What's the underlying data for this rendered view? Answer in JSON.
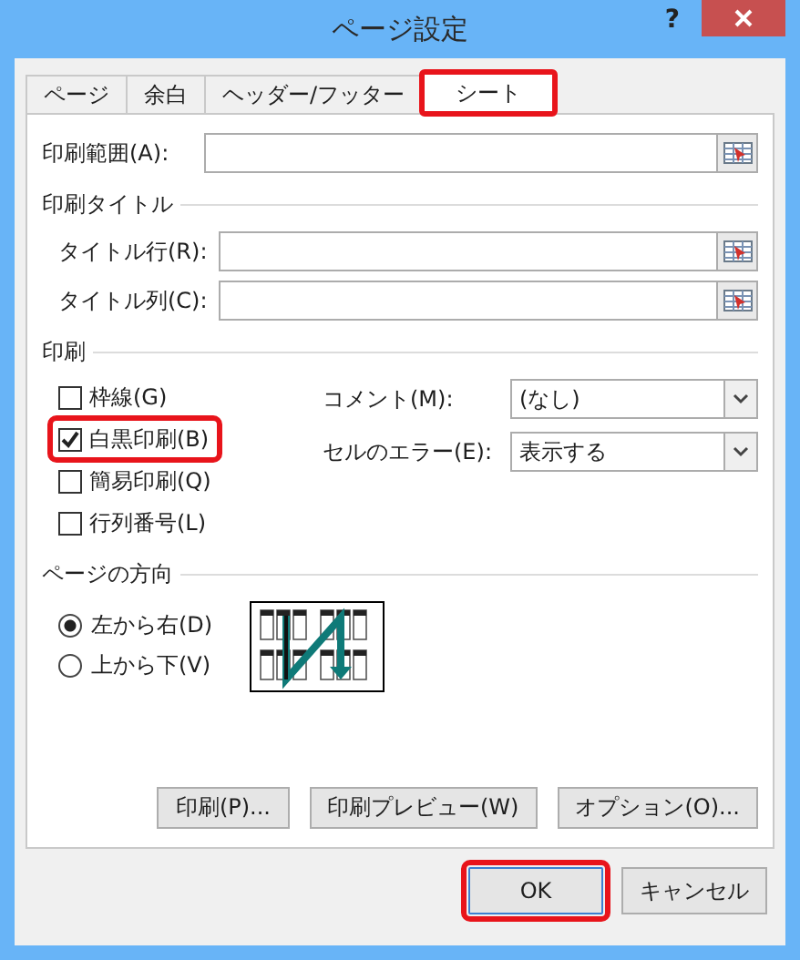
{
  "window": {
    "title": "ページ設定",
    "help": "?"
  },
  "tabs": [
    {
      "label": "ページ",
      "selected": false,
      "highlighted": false
    },
    {
      "label": "余白",
      "selected": false,
      "highlighted": false
    },
    {
      "label": "ヘッダー/フッター",
      "selected": false,
      "highlighted": false
    },
    {
      "label": "シート",
      "selected": true,
      "highlighted": true
    }
  ],
  "print_area": {
    "label": "印刷範囲(A):"
  },
  "print_titles": {
    "heading": "印刷タイトル",
    "fields": [
      {
        "label": "タイトル行(R):"
      },
      {
        "label": "タイトル列(C):"
      }
    ]
  },
  "print": {
    "heading": "印刷",
    "checkboxes": [
      {
        "label": "枠線(G)",
        "checked": false,
        "highlighted": false
      },
      {
        "label": "白黒印刷(B)",
        "checked": true,
        "highlighted": true
      },
      {
        "label": "簡易印刷(Q)",
        "checked": false,
        "highlighted": false
      },
      {
        "label": "行列番号(L)",
        "checked": false,
        "highlighted": false
      }
    ],
    "dropdowns": [
      {
        "label": "コメント(M):",
        "value": "(なし)"
      },
      {
        "label": "セルのエラー(E):",
        "value": "表示する"
      }
    ]
  },
  "page_order": {
    "heading": "ページの方向",
    "options": [
      {
        "label": "左から右(D)",
        "selected": true
      },
      {
        "label": "上から下(V)",
        "selected": false
      }
    ]
  },
  "panel_buttons": [
    "印刷(P)...",
    "印刷プレビュー(W)",
    "オプション(O)..."
  ],
  "dialog_buttons": [
    {
      "label": "OK",
      "highlighted": true
    },
    {
      "label": "キャンセル",
      "highlighted": false
    }
  ]
}
